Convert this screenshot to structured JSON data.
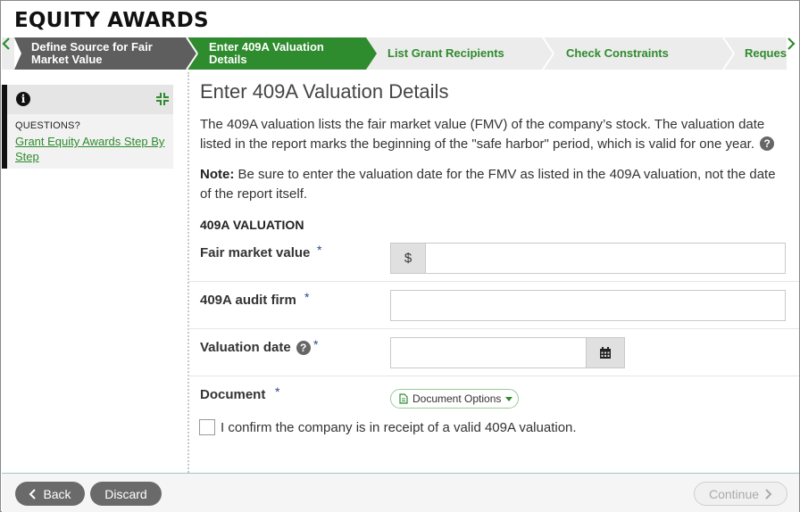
{
  "app_title": "EQUITY AWARDS",
  "wizard": {
    "steps": [
      {
        "label_line1": "Define Source for Fair",
        "label_line2": "Market Value",
        "state": "completed"
      },
      {
        "label_line1": "Enter 409A Valuation",
        "label_line2": "Details",
        "state": "current"
      },
      {
        "label": "List Grant Recipients",
        "state": "upcoming"
      },
      {
        "label": "Check Constraints",
        "state": "upcoming"
      },
      {
        "label": "Request",
        "state": "upcoming"
      }
    ]
  },
  "sidebar": {
    "questions_label": "QUESTIONS?",
    "help_link": "Grant Equity Awards Step By Step"
  },
  "main": {
    "page_title": "Enter 409A Valuation Details",
    "description": "The 409A valuation lists the fair market value (FMV) of the company’s stock. The valuation date listed in the report marks the beginning of the \"safe harbor\" period, which is valid for one year.",
    "note_label": "Note:",
    "note_text": " Be sure to enter the valuation date for the FMV as listed in the 409A valuation, not the date of the report itself.",
    "section_title": "409A VALUATION",
    "fields": {
      "fair_market_value": {
        "label": "Fair market value",
        "required": "*",
        "prefix": "$",
        "value": ""
      },
      "audit_firm": {
        "label": "409A audit firm",
        "required": "*",
        "value": ""
      },
      "valuation_date": {
        "label": "Valuation date",
        "required": "*",
        "value": ""
      },
      "document": {
        "label": "Document",
        "required": "*",
        "button": "Document Options"
      }
    },
    "confirm_text": "I confirm the company is in receipt of a valid 409A valuation."
  },
  "footer": {
    "back": "Back",
    "discard": "Discard",
    "continue": "Continue"
  },
  "colors": {
    "completed_step": "#5e5e5e",
    "current_step": "#2e8b2e",
    "upcoming_step": "#ececec",
    "upcoming_text": "#2e8b2e",
    "link": "#2e8b2e"
  }
}
